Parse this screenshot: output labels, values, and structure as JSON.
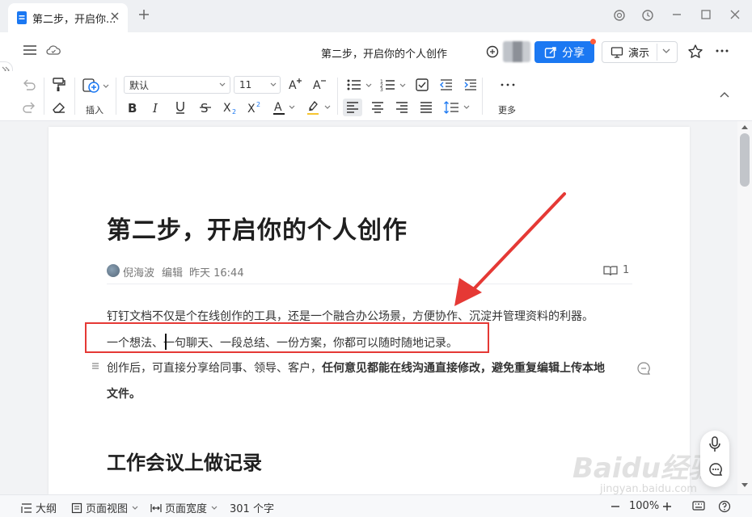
{
  "tab": {
    "title": "第二步，开启你的个人创作",
    "title_short": "第二步，开启你..."
  },
  "header": {
    "doc_title": "第二步，开启你的个人创作",
    "share_label": "分享",
    "present_label": "演示"
  },
  "toolbar": {
    "insert_label": "插入",
    "font_name": "默认",
    "font_size": "11",
    "more_label": "更多",
    "colors": {
      "accent": "#1b78f2",
      "highlight": "#f7c531",
      "underline": "#222222"
    }
  },
  "document": {
    "heading": "第二步，开启你的个人创作",
    "meta": {
      "author": "倪海波",
      "action": "编辑",
      "time": "昨天 16:44",
      "read_count": "1"
    },
    "paragraphs": {
      "p1": "钉钉文档不仅是个在线创作的工具，还是一个融合办公场景，方便协作、沉淀并管理资料的利器。",
      "p2": "一个想法、一句聊天、一段总结、一份方案，你都可以随时随地记录。",
      "p3_normal": "创作后，可直接分享给同事、领导、客户，",
      "p3_bold1": "任何意见都能在线沟通直接修改，避免重复编辑上传本地",
      "p3_bold2": "文件。"
    },
    "heading2": "工作会议上做记录"
  },
  "statusbar": {
    "outline": "大纲",
    "page_view": "页面视图",
    "page_width": "页面宽度",
    "word_count": "301 个字",
    "zoom": "100%"
  },
  "watermark": {
    "main": "Baidu经验",
    "sub": "jingyan.baidu.com"
  },
  "annotations": {
    "box_color": "#e53935",
    "arrow_color": "#e53935"
  }
}
